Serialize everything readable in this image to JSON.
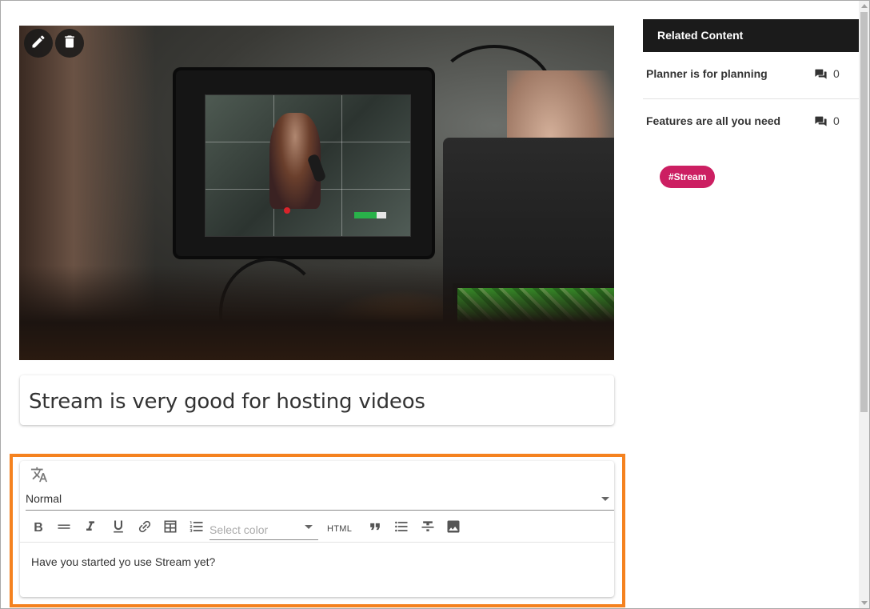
{
  "hero": {
    "image_alt": "Camera rig with monitor filming a woman singing into a microphone"
  },
  "image_actions": {
    "edit_icon": "pencil-icon",
    "delete_icon": "trash-icon"
  },
  "post": {
    "title": "Stream is very good for hosting videos"
  },
  "editor": {
    "translate_icon": "translate-icon",
    "style_value": "Normal",
    "toolbar": {
      "bold": "B",
      "color_placeholder": "Select color",
      "html_label": "HTML",
      "quote": "”"
    },
    "body_text": "Have you started yo use Stream yet?",
    "highlight_color": "#f5821f"
  },
  "sidebar": {
    "header": "Related Content",
    "items": [
      {
        "title": "Planner is for planning",
        "comment_count": "0"
      },
      {
        "title": "Features are all you need",
        "comment_count": "0"
      }
    ],
    "tag": "#Stream",
    "tag_color": "#cc1f62"
  }
}
